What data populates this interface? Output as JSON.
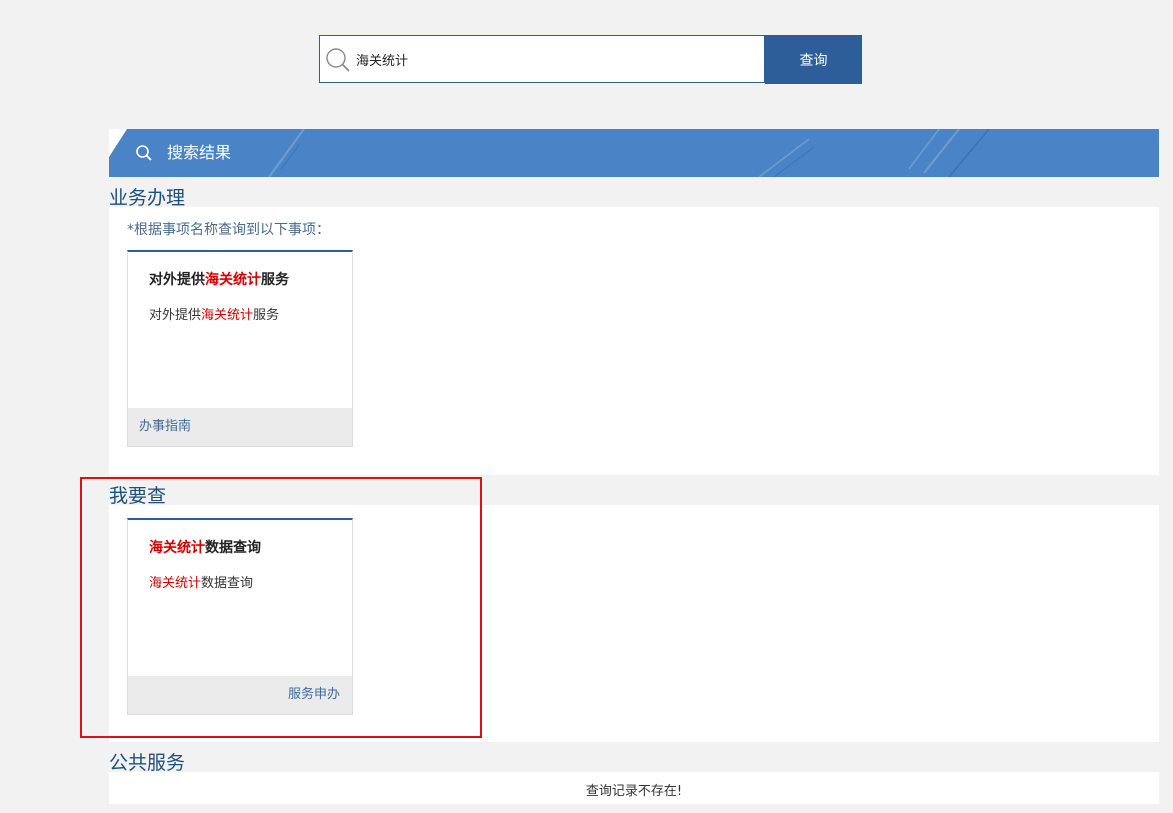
{
  "search": {
    "value": "海关统计",
    "button_label": "查询"
  },
  "results_header": {
    "title": "搜索结果"
  },
  "sections": {
    "business": {
      "title": "业务办理",
      "note": "*根据事项名称查询到以下事项：",
      "card": {
        "title_prefix": "对外提供",
        "title_highlight": "海关统计",
        "title_suffix": "服务",
        "desc_prefix": "对外提供",
        "desc_highlight": "海关统计",
        "desc_suffix": "服务",
        "footer_link": "办事指南"
      }
    },
    "query": {
      "title": "我要查",
      "card": {
        "title_highlight": "海关统计",
        "title_suffix": "数据查询",
        "desc_highlight": "海关统计",
        "desc_suffix": "数据查询",
        "footer_link": "服务申办"
      }
    },
    "public": {
      "title": "公共服务",
      "empty_message": "查询记录不存在!"
    }
  },
  "colors": {
    "accent": "#2e5e9a",
    "header_bar": "#4a84c6",
    "highlight_text": "#d40000",
    "annotation_box": "#e01010"
  },
  "icons": {
    "search": "search-icon"
  }
}
